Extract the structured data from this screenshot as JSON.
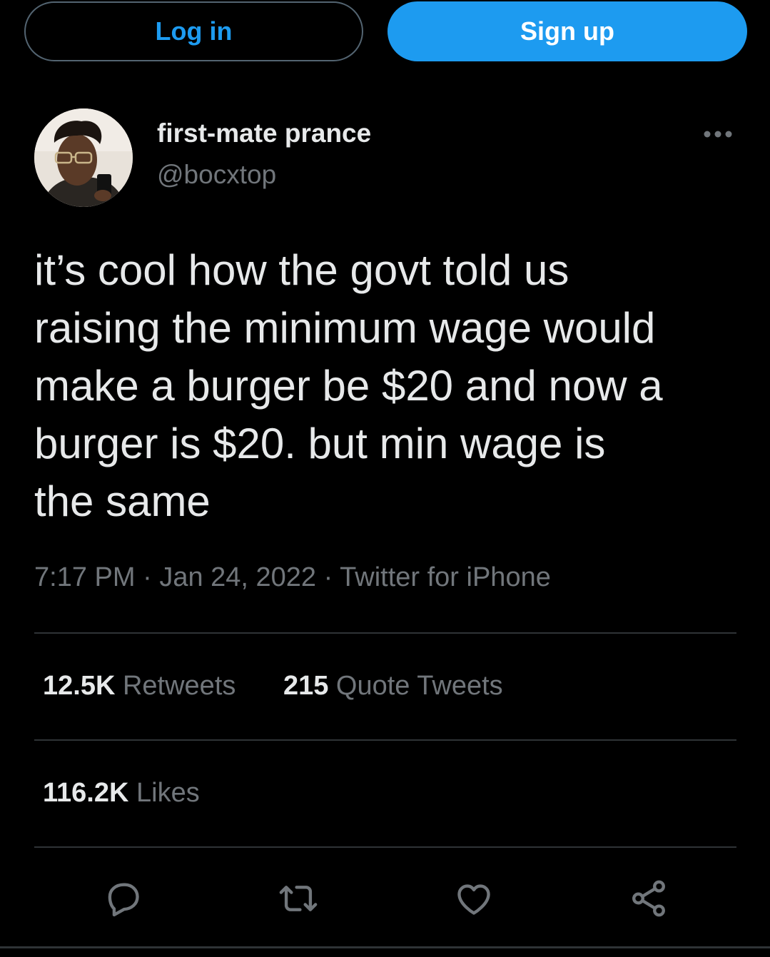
{
  "header": {
    "login_label": "Log in",
    "signup_label": "Sign up"
  },
  "author": {
    "display_name": "first-mate prance",
    "handle": "@bocxtop",
    "avatar_icon": "user-photo-avatar"
  },
  "tweet": {
    "lines": [
      "it’s cool how the govt told us",
      "raising the minimum wage would",
      "make a burger be $20 and now a",
      "burger is $20. but min wage is",
      "the same"
    ],
    "time": "7:17 PM",
    "date": "Jan 24, 2022",
    "source": "Twitter for iPhone",
    "separator": "·"
  },
  "stats": {
    "retweets_count": "12.5K",
    "retweets_label": "Retweets",
    "quotes_count": "215",
    "quotes_label": "Quote Tweets",
    "likes_count": "116.2K",
    "likes_label": "Likes"
  },
  "actions": [
    "reply-icon",
    "retweet-icon",
    "like-icon",
    "share-icon"
  ],
  "colors": {
    "background": "#000000",
    "accent": "#1d9bf0",
    "text": "#e7e9ea",
    "muted": "#71767b",
    "divider": "#2f3336"
  }
}
